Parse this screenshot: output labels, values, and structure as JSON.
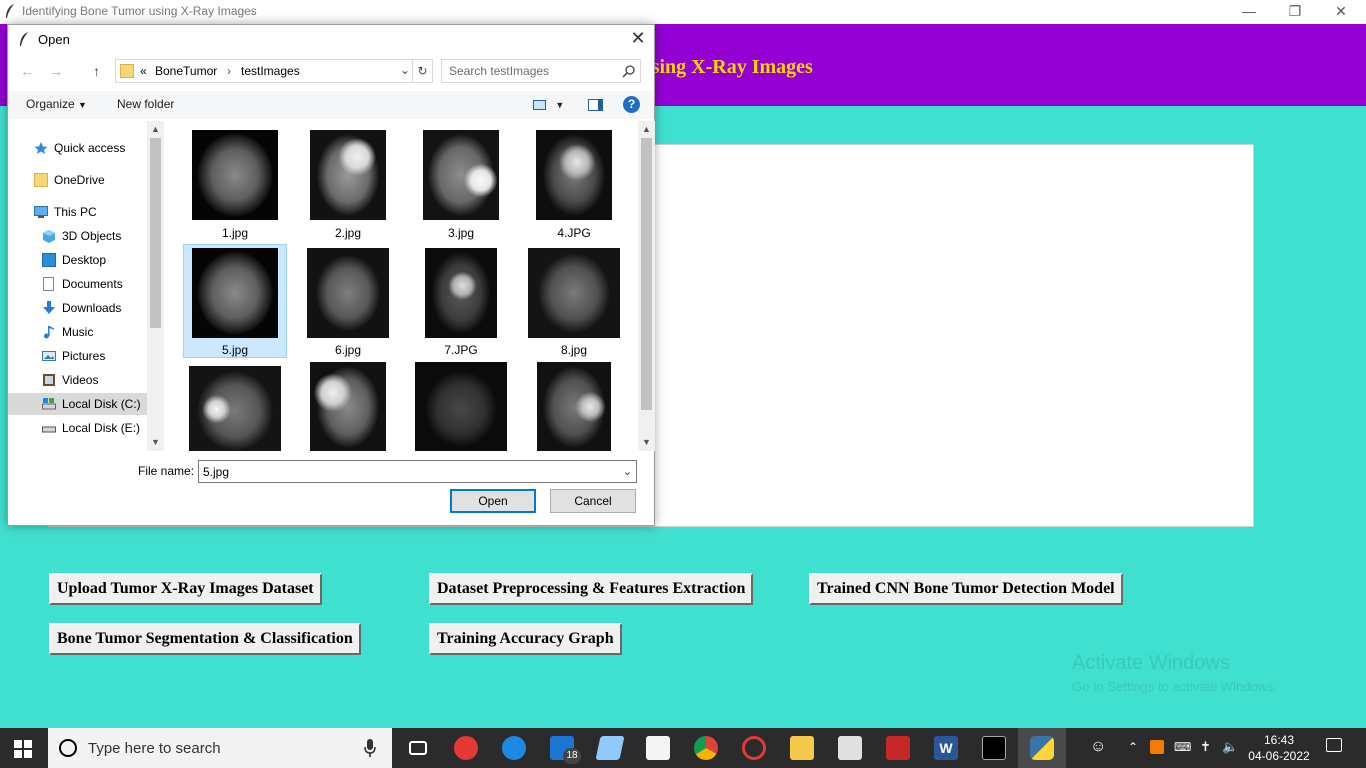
{
  "app": {
    "window_title": "Identifying Bone Tumor using X-Ray Images",
    "heading": "ne Tumor using X-Ray Images",
    "buttons": {
      "upload": "Upload Tumor X-Ray Images Dataset",
      "preprocess": "Dataset Preprocessing & Features Extraction",
      "trained_cnn": "Trained CNN Bone Tumor Detection Model",
      "segmentation": "Bone Tumor Segmentation & Classification",
      "accuracy_graph": "Training Accuracy Graph"
    },
    "colors": {
      "background": "#40e0d0",
      "header": "#9400d3",
      "heading_text": "#ffd700"
    }
  },
  "dialog": {
    "title": "Open",
    "breadcrumb": [
      "BoneTumor",
      "testImages"
    ],
    "breadcrumb_prefix": "«",
    "search_placeholder": "Search testImages",
    "toolbar": {
      "organize": "Organize",
      "new_folder": "New folder"
    },
    "sidebar": [
      {
        "label": "Quick access",
        "icon": "star-icon"
      },
      {
        "label": "OneDrive",
        "icon": "folder-icon"
      },
      {
        "label": "This PC",
        "icon": "computer-icon"
      },
      {
        "label": "3D Objects",
        "icon": "cube-icon"
      },
      {
        "label": "Desktop",
        "icon": "desktop-icon"
      },
      {
        "label": "Documents",
        "icon": "document-icon"
      },
      {
        "label": "Downloads",
        "icon": "download-icon"
      },
      {
        "label": "Music",
        "icon": "music-icon"
      },
      {
        "label": "Pictures",
        "icon": "pictures-icon"
      },
      {
        "label": "Videos",
        "icon": "video-icon"
      },
      {
        "label": "Local Disk (C:)",
        "icon": "drive-icon",
        "selected": true
      },
      {
        "label": "Local Disk (E:)",
        "icon": "drive-icon"
      }
    ],
    "files": [
      {
        "name": "1.jpg"
      },
      {
        "name": "2.jpg"
      },
      {
        "name": "3.jpg"
      },
      {
        "name": "4.JPG"
      },
      {
        "name": "5.jpg",
        "selected": true
      },
      {
        "name": "6.jpg"
      },
      {
        "name": "7.JPG"
      },
      {
        "name": "8.jpg"
      },
      {
        "name": ""
      },
      {
        "name": ""
      },
      {
        "name": ""
      },
      {
        "name": ""
      }
    ],
    "file_name_label": "File name:",
    "file_name_value": "5.jpg",
    "open_button": "Open",
    "cancel_button": "Cancel"
  },
  "watermark": {
    "line1": "Activate Windows",
    "line2": "Go to Settings to activate Windows."
  },
  "taskbar": {
    "search_placeholder": "Type here to search",
    "mail_badge": "18",
    "clock_time": "16:43",
    "clock_date": "04-06-2022"
  }
}
